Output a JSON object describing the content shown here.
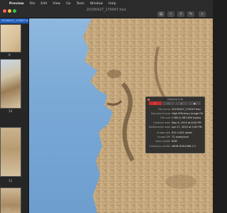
{
  "menubar": {
    "app_name": "Preview",
    "items": [
      "File",
      "Edit",
      "View",
      "Go",
      "Tools",
      "Window",
      "Help"
    ]
  },
  "window": {
    "title": "20190427_170047.heic"
  },
  "sidebar": {
    "selected_label": "20190427_170047.heic",
    "thumbnails": [
      {
        "number": "9"
      },
      {
        "number": "10"
      },
      {
        "number": "11"
      },
      {
        "number": "12"
      }
    ]
  },
  "inspector": {
    "title": "General Info",
    "tabs": [
      {
        "icon": "info-icon"
      },
      {
        "icon": "ruler-icon"
      },
      {
        "icon": "tag-icon"
      },
      {
        "icon": "camera-icon"
      }
    ],
    "fields": [
      {
        "key": "File name",
        "value": "20190427_170047.heic"
      },
      {
        "key": "Document type",
        "value": "High Efficiency Image File Format"
      },
      {
        "key": "File size",
        "value": "2 MB (1,987,600 bytes)"
      },
      {
        "key": "Creation date",
        "value": "May 6, 2019 at 8:00 PM"
      },
      {
        "key": "Modification date",
        "value": "Apr 27, 2019 at 5:00 PM"
      },
      {
        "key": "Image size",
        "value": "612 x 832 pixels"
      },
      {
        "key": "Image DPI",
        "value": "72 pixels/inch"
      },
      {
        "key": "Color model",
        "value": "RGB"
      },
      {
        "key": "ColorSync profile",
        "value": "sRGB IEC61966-2.1"
      }
    ]
  },
  "colors": {
    "sky": "#7aa9d6",
    "rock": "#c8ad82",
    "accent": "#c62d2d"
  }
}
